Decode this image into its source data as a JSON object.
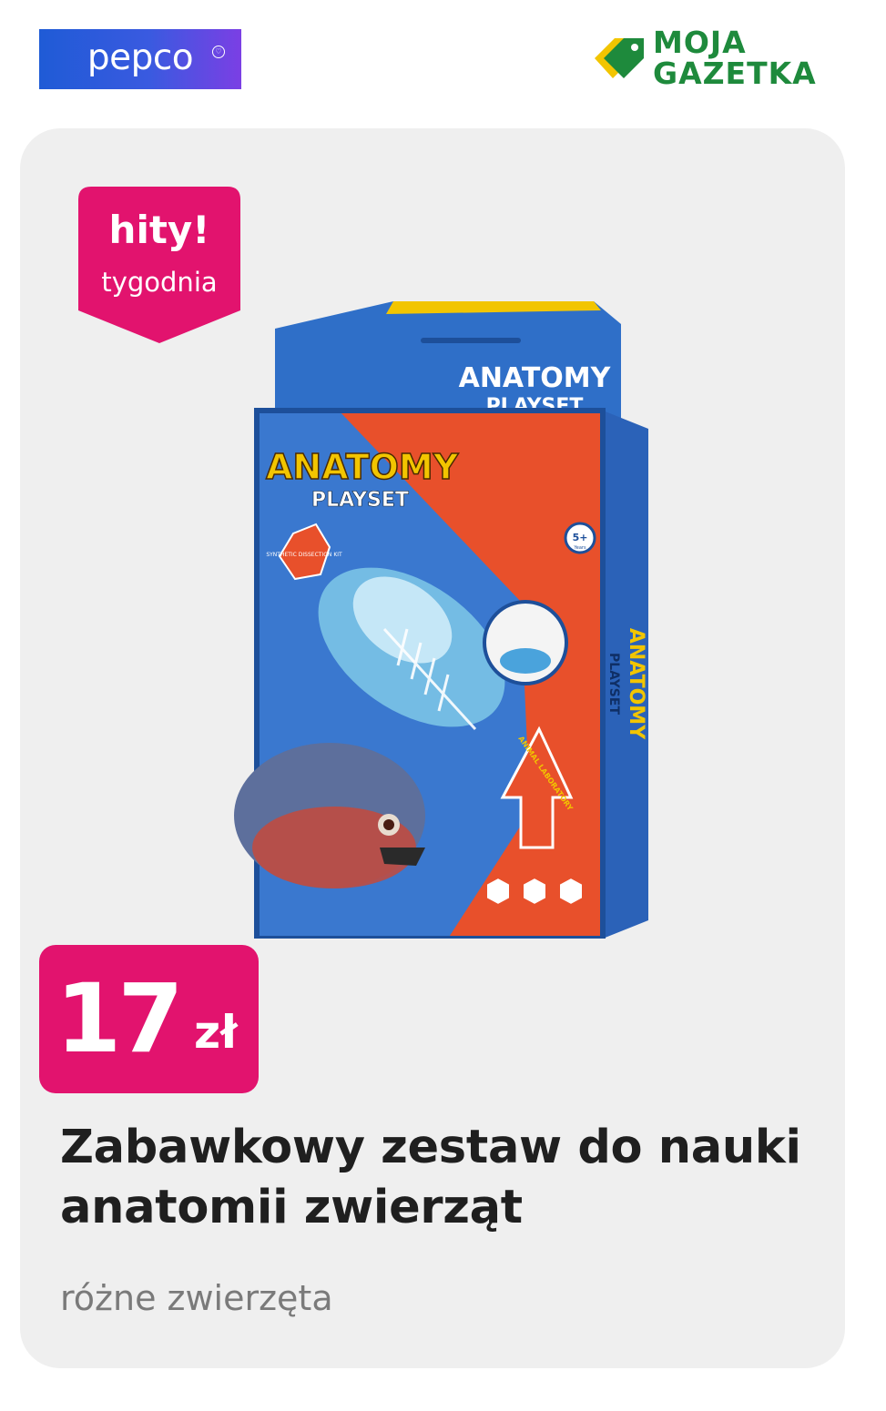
{
  "header": {
    "pepco_logo_text": "pepco",
    "mojagazetka_line1": "MOJA",
    "mojagazetka_line2": "GAZETKA"
  },
  "badge": {
    "title": "hity!",
    "subtitle": "tygodnia"
  },
  "product": {
    "package_title": "ANATOMY",
    "package_subtitle": "PLAYSET",
    "package_side_title": "ANATOMY",
    "package_side_subtitle": "PLAYSET",
    "sticker_text": "SYNTHETIC DISSECTION KIT",
    "age_badge": "5+",
    "age_badge_sub": "Years",
    "arrow_text": "ANIMAL LABORATORY"
  },
  "price": {
    "amount": "17",
    "currency": "zł"
  },
  "item": {
    "title": "Zabawkowy zestaw do nauki anatomii zwierząt",
    "subtitle": "różne zwierzęta"
  },
  "colors": {
    "price_bg": "#e2136e",
    "badge_bg": "#e2136e",
    "brand_green": "#1e8a3c",
    "card_bg": "#efefef"
  }
}
